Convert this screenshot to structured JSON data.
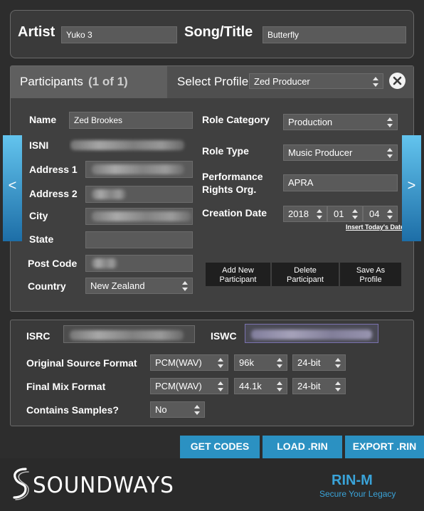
{
  "header": {
    "artist_label": "Artist",
    "artist_value": "Yuko 3",
    "song_label": "Song/Title",
    "song_value": "Butterfly"
  },
  "participants": {
    "title": "Participants",
    "count": "(1 of 1)",
    "select_profile_label": "Select Profile",
    "profile_value": "Zed Producer",
    "fields": {
      "name_label": "Name",
      "name_value": "Zed Brookes",
      "isni_label": "ISNI",
      "address1_label": "Address 1",
      "address2_label": "Address 2",
      "city_label": "City",
      "state_label": "State",
      "postcode_label": "Post Code",
      "country_label": "Country",
      "country_value": "New Zealand",
      "role_category_label": "Role Category",
      "role_category_value": "Production",
      "role_type_label": "Role Type",
      "role_type_value": "Music Producer",
      "pro_label_line1": "Performance",
      "pro_label_line2": "Rights Org.",
      "pro_value": "APRA",
      "creation_date_label": "Creation Date",
      "date_year": "2018",
      "date_month": "01",
      "date_day": "04",
      "insert_today_link": "Insert Today's Date"
    },
    "buttons": {
      "add_new_line1": "Add New",
      "add_new_line2": "Participant",
      "delete_line1": "Delete",
      "delete_line2": "Participant",
      "save_line1": "Save As",
      "save_line2": "Profile"
    },
    "nav": {
      "prev": "<",
      "next": ">"
    }
  },
  "codes": {
    "isrc_label": "ISRC",
    "iswc_label": "ISWC",
    "original_label": "Original Source Format",
    "original_format": "PCM(WAV)",
    "original_rate": "96k",
    "original_bits": "24-bit",
    "final_label": "Final Mix Format",
    "final_format": "PCM(WAV)",
    "final_rate": "44.1k",
    "final_bits": "24-bit",
    "samples_label": "Contains Samples?",
    "samples_value": "No"
  },
  "actions": {
    "get_codes": "GET CODES",
    "load_rin": "LOAD .RIN",
    "export_rin": "EXPORT .RIN"
  },
  "footer": {
    "brand": "SOUNDWAYS",
    "product": "RIN-M",
    "tagline": "Secure Your Legacy"
  },
  "colors": {
    "accent_blue": "#2b91c2",
    "nav_blue": "#3aa3d8"
  }
}
